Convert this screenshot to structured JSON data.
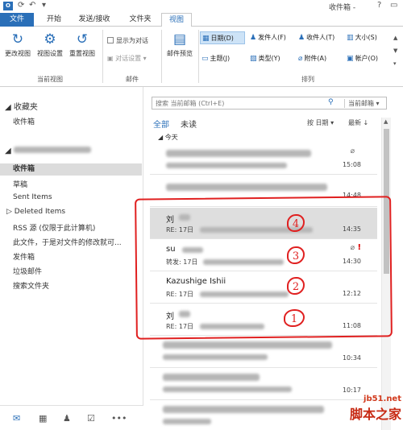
{
  "window": {
    "app_icon": "O",
    "title": "收件箱 - ",
    "help": "?",
    "restore": "▭"
  },
  "tabs": [
    {
      "label": "文件"
    },
    {
      "label": "开始"
    },
    {
      "label": "发送/接收"
    },
    {
      "label": "文件夹"
    },
    {
      "label": "视图"
    }
  ],
  "ribbon": {
    "current_view": {
      "change_view": "更改视图",
      "view_settings": "视图设置",
      "reset_view": "重置视图",
      "group_label": "当前视图"
    },
    "messages": {
      "show_as_conversations": "显示为对话",
      "conversation_settings": "对话设置",
      "group_label": "邮件"
    },
    "arrangement": {
      "reading_preview": "邮件预览",
      "date": "日期(D)",
      "from": "发件人(F)",
      "to": "收件人(T)",
      "size": "大小(S)",
      "subject": "主题(J)",
      "type": "类型(Y)",
      "attachments": "附件(A)",
      "account": "帐户(O)",
      "group_label": "排列"
    }
  },
  "nav": {
    "favorites_header": "收藏夹",
    "favorites_inbox": "收件箱",
    "folders": [
      {
        "label": "收件箱"
      },
      {
        "label": "草稿"
      },
      {
        "label": "Sent Items"
      },
      {
        "label": "Deleted Items"
      },
      {
        "label": "RSS 源 (仅限于此计算机)"
      },
      {
        "label": "此文件，于是对文件的修改就可..."
      },
      {
        "label": "发件箱"
      },
      {
        "label": "垃圾邮件"
      },
      {
        "label": "搜索文件夹"
      }
    ]
  },
  "list": {
    "search_placeholder": "搜索 当前邮箱 (Ctrl+E)",
    "search_scope": "当前邮箱",
    "filter_all": "全部",
    "filter_unread": "未读",
    "sort_by": "按 日期",
    "sort_order": "最新",
    "group_header": "今天",
    "messages": [
      {
        "sender": "",
        "subject": "",
        "time": "15:08",
        "attachment": true,
        "flag": false
      },
      {
        "sender": "",
        "subject": "",
        "time": "14:48",
        "attachment": false,
        "flag": false
      },
      {
        "sender": "刘",
        "subject": "RE: 17日",
        "time": "14:35",
        "attachment": false,
        "flag": false
      },
      {
        "sender": "su",
        "subject": "转发: 17日",
        "time": "14:30",
        "attachment": true,
        "flag": true
      },
      {
        "sender": "Kazushige Ishii",
        "subject": "RE: 17日",
        "time": "12:12",
        "attachment": false,
        "flag": false
      },
      {
        "sender": "刘",
        "subject": "RE: 17日",
        "time": "11:08",
        "attachment": false,
        "flag": false
      },
      {
        "sender": "",
        "subject": "",
        "time": "10:34",
        "attachment": false,
        "flag": false
      },
      {
        "sender": "",
        "subject": "",
        "time": "10:17",
        "attachment": false,
        "flag": false
      }
    ]
  },
  "annotations": [
    "4",
    "3",
    "2",
    "1"
  ],
  "watermark": {
    "site": "jb51.net",
    "name": "脚本之家"
  },
  "colors": {
    "accent": "#2a6fb8",
    "annotation": "#e02020",
    "selected_row": "#dedede"
  }
}
